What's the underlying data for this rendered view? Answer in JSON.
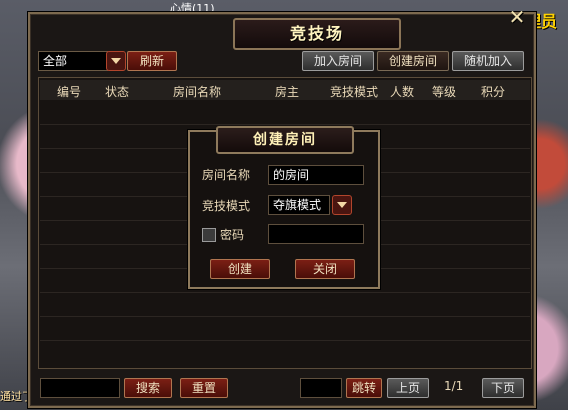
{
  "scene": {
    "top_name": "心情(11)",
    "corner_text": "理员",
    "bottom_left_text": "通过了"
  },
  "window": {
    "title": "竞技场",
    "close_glyph": "✕"
  },
  "toolbar": {
    "filter_value": "全部",
    "refresh_label": "刷新",
    "join_room_label": "加入房间",
    "create_room_label": "创建房间",
    "random_join_label": "随机加入"
  },
  "table": {
    "columns": [
      "编号",
      "状态",
      "房间名称",
      "房主",
      "竞技模式",
      "人数",
      "等级",
      "积分"
    ]
  },
  "dialog": {
    "title": "创建房间",
    "room_name_label": "房间名称",
    "room_name_value": "的房间",
    "mode_label": "竞技模式",
    "mode_value": "夺旗模式",
    "password_label": "密码",
    "password_value": "",
    "create_label": "创建",
    "close_label": "关闭"
  },
  "footer": {
    "search_value": "",
    "search_label": "搜索",
    "reset_label": "重置",
    "jump_value": "",
    "jump_label": "跳转",
    "prev_label": "上页",
    "page_indicator": "1/1",
    "next_label": "下页"
  }
}
